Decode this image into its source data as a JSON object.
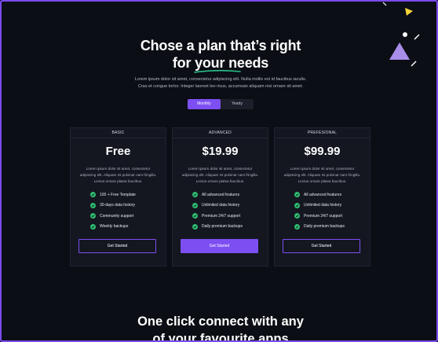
{
  "hero": {
    "title_line1": "Chose a plan that’s right",
    "title_line2_prefix": "for ",
    "title_line2_highlight": "your needs",
    "subtitle_line1": "Lorem ipsum dolor sit amet, consectetur adipiscing elit. Nulla mollis est id faucibus iaculis.",
    "subtitle_line2": "Cras et congue tortor. Integer laoreet leo risus, accumsan aliquam nisi ornare sit amet.",
    "highlight_color": "#2bbf8a"
  },
  "billing_toggle": {
    "monthly_label": "Monthly",
    "yearly_label": "Yearly",
    "selected": "Monthly"
  },
  "plans": [
    {
      "tier": "BASIC",
      "price": "Free",
      "desc_line1": "Lorem ipsum dolor sit amet, consectetur",
      "desc_line2": "adipiscing elit. Aliquam mi pulvinar nam fringilla.",
      "desc_line3": "Lectus ornare platea faucibus.",
      "features": [
        "100 + Free Template",
        "30-days data history",
        "Community support",
        "Weekly backups"
      ],
      "cta_label": "Get Started"
    },
    {
      "tier": "ADVANCED",
      "price": "$19.99",
      "desc_line1": "Lorem ipsum dolor sit amet, consectetur",
      "desc_line2": "adipiscing elit. Aliquam mi pulvinar nam fringilla.",
      "desc_line3": "Lectus ornare platea faucibus.",
      "features": [
        "All advanced features",
        "Unlimited data history",
        "Premium 24/7 support",
        "Daily premium backups"
      ],
      "cta_label": "Get Started"
    },
    {
      "tier": "PREFESIONAL",
      "price": "$99.99",
      "desc_line1": "Lorem ipsum dolor sit amet, consectetur",
      "desc_line2": "adipiscing elit. Aliquam mi pulvinar nam fringilla.",
      "desc_line3": "Lectus ornare platea faucibus.",
      "features": [
        "All advanced features",
        "Unlimited data history",
        "Premium 24/7 support",
        "Daily premium backups"
      ],
      "cta_label": "Get Started"
    }
  ],
  "next_section": {
    "title_line1": "One click connect with any",
    "title_line2": "of your favourite apps"
  },
  "colors": {
    "accent": "#7d4ff2",
    "check": "#2fbf71",
    "background": "#0c0e15",
    "card": "#141720"
  },
  "icons": [
    "check-circle-icon",
    "triangle-decoration",
    "dot-decoration"
  ]
}
